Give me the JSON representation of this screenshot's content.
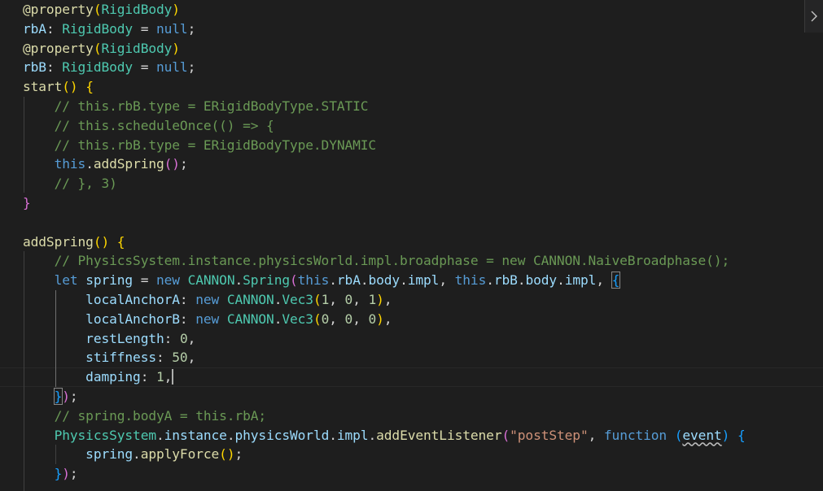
{
  "editor": {
    "language": "TypeScript",
    "lines": [
      {
        "indent": 0,
        "tokens": [
          [
            "fn",
            "@property"
          ],
          [
            "br1",
            "("
          ],
          [
            "cls",
            "RigidBody"
          ],
          [
            "br1",
            ")"
          ]
        ]
      },
      {
        "indent": 0,
        "tokens": [
          [
            "var",
            "rbA"
          ],
          [
            "p",
            ": "
          ],
          [
            "cls",
            "RigidBody"
          ],
          [
            "p",
            " = "
          ],
          [
            "kw",
            "null"
          ],
          [
            "p",
            ";"
          ]
        ]
      },
      {
        "indent": 0,
        "tokens": [
          [
            "fn",
            "@property"
          ],
          [
            "br1",
            "("
          ],
          [
            "cls",
            "RigidBody"
          ],
          [
            "br1",
            ")"
          ]
        ]
      },
      {
        "indent": 0,
        "tokens": [
          [
            "var",
            "rbB"
          ],
          [
            "p",
            ": "
          ],
          [
            "cls",
            "RigidBody"
          ],
          [
            "p",
            " = "
          ],
          [
            "kw",
            "null"
          ],
          [
            "p",
            ";"
          ]
        ]
      },
      {
        "indent": 0,
        "tokens": [
          [
            "fn",
            "start"
          ],
          [
            "br1",
            "()"
          ],
          [
            "p",
            " "
          ],
          [
            "br1",
            "{"
          ]
        ]
      },
      {
        "indent": 1,
        "tokens": [
          [
            "cmt",
            "// this.rbB.type = ERigidBodyType.STATIC"
          ]
        ]
      },
      {
        "indent": 1,
        "tokens": [
          [
            "cmt",
            "// this.scheduleOnce(() => {"
          ]
        ]
      },
      {
        "indent": 1,
        "tokens": [
          [
            "cmt",
            "// this.rbB.type = ERigidBodyType.DYNAMIC"
          ]
        ]
      },
      {
        "indent": 1,
        "tokens": [
          [
            "kw",
            "this"
          ],
          [
            "p",
            "."
          ],
          [
            "fn",
            "addSpring"
          ],
          [
            "br2",
            "()"
          ],
          [
            "p",
            ";"
          ]
        ]
      },
      {
        "indent": 1,
        "tokens": [
          [
            "cmt",
            "// }, 3)"
          ]
        ]
      },
      {
        "indent": 0,
        "tokens": [
          [
            "br2",
            "}"
          ]
        ]
      },
      {
        "indent": 0,
        "tokens": []
      },
      {
        "indent": 0,
        "tokens": [
          [
            "fn",
            "addSpring"
          ],
          [
            "br1",
            "()"
          ],
          [
            "p",
            " "
          ],
          [
            "br1",
            "{"
          ]
        ]
      },
      {
        "indent": 1,
        "tokens": [
          [
            "cmt",
            "// PhysicsSystem.instance.physicsWorld.impl.broadphase = new CANNON.NaiveBroadphase();"
          ]
        ]
      },
      {
        "indent": 1,
        "tokens": [
          [
            "kw",
            "let"
          ],
          [
            "p",
            " "
          ],
          [
            "var",
            "spring"
          ],
          [
            "p",
            " = "
          ],
          [
            "kw",
            "new"
          ],
          [
            "p",
            " "
          ],
          [
            "cls",
            "CANNON"
          ],
          [
            "p",
            "."
          ],
          [
            "cls",
            "Spring"
          ],
          [
            "br2",
            "("
          ],
          [
            "kw",
            "this"
          ],
          [
            "p",
            "."
          ],
          [
            "var",
            "rbA"
          ],
          [
            "p",
            "."
          ],
          [
            "var",
            "body"
          ],
          [
            "p",
            "."
          ],
          [
            "var",
            "impl"
          ],
          [
            "p",
            ", "
          ],
          [
            "kw",
            "this"
          ],
          [
            "p",
            "."
          ],
          [
            "var",
            "rbB"
          ],
          [
            "p",
            "."
          ],
          [
            "var",
            "body"
          ],
          [
            "p",
            "."
          ],
          [
            "var",
            "impl"
          ],
          [
            "p",
            ", "
          ],
          [
            "br3bm",
            "{"
          ]
        ]
      },
      {
        "indent": 2,
        "tokens": [
          [
            "var",
            "localAnchorA"
          ],
          [
            "p",
            ": "
          ],
          [
            "kw",
            "new"
          ],
          [
            "p",
            " "
          ],
          [
            "cls",
            "CANNON"
          ],
          [
            "p",
            "."
          ],
          [
            "cls",
            "Vec3"
          ],
          [
            "br1",
            "("
          ],
          [
            "num",
            "1"
          ],
          [
            "p",
            ", "
          ],
          [
            "num",
            "0"
          ],
          [
            "p",
            ", "
          ],
          [
            "num",
            "1"
          ],
          [
            "br1",
            ")"
          ],
          [
            "p",
            ","
          ]
        ]
      },
      {
        "indent": 2,
        "tokens": [
          [
            "var",
            "localAnchorB"
          ],
          [
            "p",
            ": "
          ],
          [
            "kw",
            "new"
          ],
          [
            "p",
            " "
          ],
          [
            "cls",
            "CANNON"
          ],
          [
            "p",
            "."
          ],
          [
            "cls",
            "Vec3"
          ],
          [
            "br1",
            "("
          ],
          [
            "num",
            "0"
          ],
          [
            "p",
            ", "
          ],
          [
            "num",
            "0"
          ],
          [
            "p",
            ", "
          ],
          [
            "num",
            "0"
          ],
          [
            "br1",
            ")"
          ],
          [
            "p",
            ","
          ]
        ]
      },
      {
        "indent": 2,
        "tokens": [
          [
            "var",
            "restLength"
          ],
          [
            "p",
            ": "
          ],
          [
            "num",
            "0"
          ],
          [
            "p",
            ","
          ]
        ]
      },
      {
        "indent": 2,
        "tokens": [
          [
            "var",
            "stiffness"
          ],
          [
            "p",
            ": "
          ],
          [
            "num",
            "50"
          ],
          [
            "p",
            ","
          ]
        ]
      },
      {
        "indent": 2,
        "tokens": [
          [
            "var",
            "damping"
          ],
          [
            "p",
            ": "
          ],
          [
            "num",
            "1"
          ],
          [
            "p",
            ","
          ],
          [
            "cursor",
            ""
          ]
        ]
      },
      {
        "indent": 1,
        "tokens": [
          [
            "br3bm",
            "}"
          ],
          [
            "br2",
            ")"
          ],
          [
            "p",
            ";"
          ]
        ]
      },
      {
        "indent": 1,
        "tokens": [
          [
            "cmt",
            "// spring.bodyA = this.rbA;"
          ]
        ]
      },
      {
        "indent": 1,
        "tokens": [
          [
            "cls",
            "PhysicsSystem"
          ],
          [
            "p",
            "."
          ],
          [
            "var",
            "instance"
          ],
          [
            "p",
            "."
          ],
          [
            "var",
            "physicsWorld"
          ],
          [
            "p",
            "."
          ],
          [
            "var",
            "impl"
          ],
          [
            "p",
            "."
          ],
          [
            "fn",
            "addEventListener"
          ],
          [
            "br2",
            "("
          ],
          [
            "str",
            "\"postStep\""
          ],
          [
            "p",
            ", "
          ],
          [
            "kw",
            "function"
          ],
          [
            "p",
            " "
          ],
          [
            "br3",
            "("
          ],
          [
            "varsq",
            "event"
          ],
          [
            "br3",
            ")"
          ],
          [
            "p",
            " "
          ],
          [
            "br3",
            "{"
          ]
        ]
      },
      {
        "indent": 2,
        "tokens": [
          [
            "var",
            "spring"
          ],
          [
            "p",
            "."
          ],
          [
            "fn",
            "applyForce"
          ],
          [
            "br1",
            "()"
          ],
          [
            "p",
            ";"
          ]
        ]
      },
      {
        "indent": 1,
        "tokens": [
          [
            "br3",
            "}"
          ],
          [
            "br2",
            ")"
          ],
          [
            "p",
            ";"
          ]
        ]
      }
    ]
  },
  "scroll_button": {
    "icon": "chevron-right-icon"
  }
}
